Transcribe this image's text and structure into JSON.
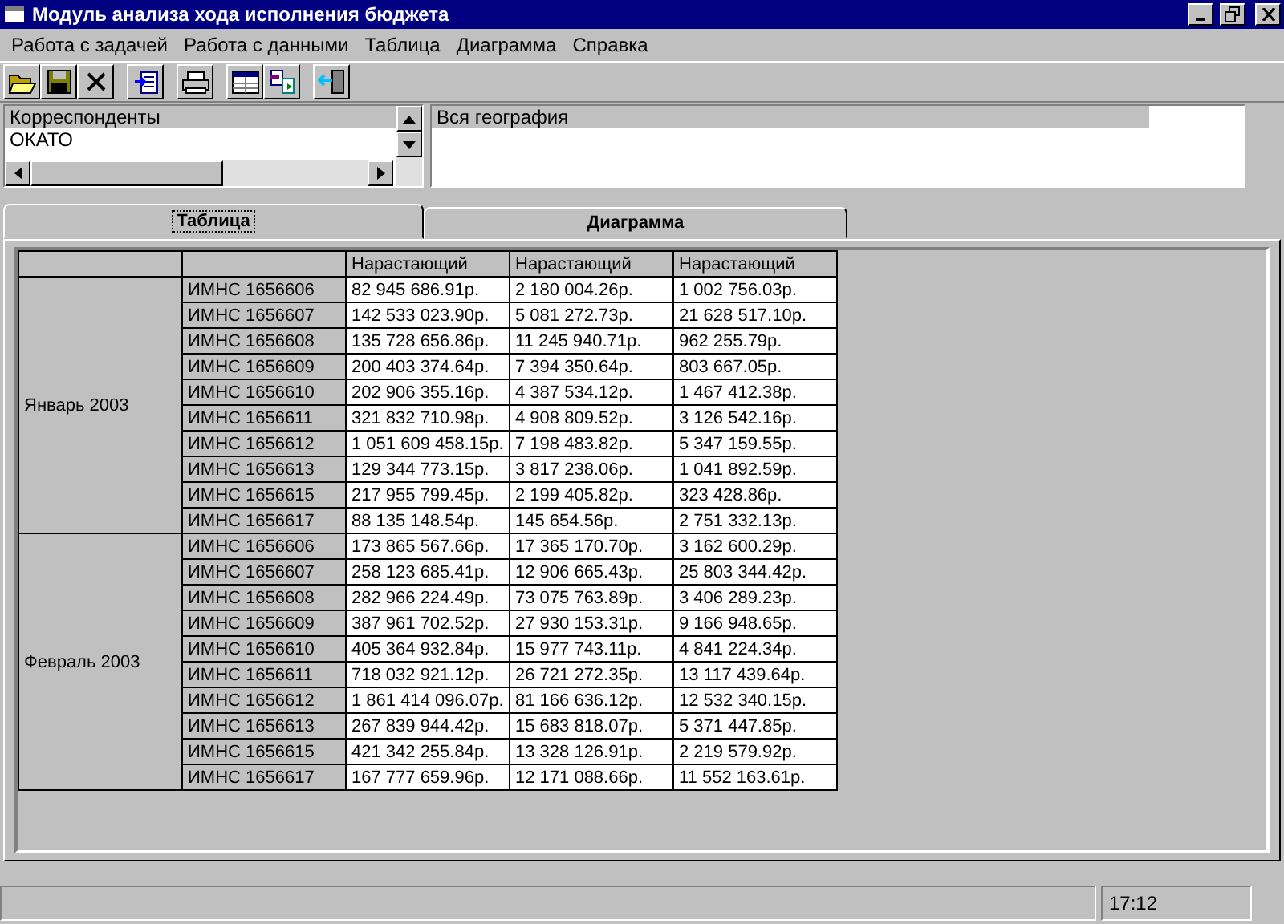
{
  "window": {
    "title": "Модуль анализа хода исполнения бюджета"
  },
  "menu": [
    "Работа с задачей",
    "Работа с данными",
    "Таблица",
    "Диаграмма",
    "Справка"
  ],
  "toolbar": [
    {
      "kind": "open"
    },
    {
      "kind": "save"
    },
    {
      "kind": "delete"
    },
    {
      "kind": "separator"
    },
    {
      "kind": "import"
    },
    {
      "kind": "separator"
    },
    {
      "kind": "print"
    },
    {
      "kind": "separator"
    },
    {
      "kind": "table"
    },
    {
      "kind": "transfer"
    },
    {
      "kind": "separator"
    },
    {
      "kind": "exit"
    }
  ],
  "left_list": {
    "items": [
      {
        "label": "Корреспонденты",
        "selected": true
      },
      {
        "label": "ОКАТО",
        "selected": false
      }
    ]
  },
  "right_list": {
    "items": [
      {
        "label": "Вся география",
        "selected": true
      }
    ]
  },
  "tabs": [
    {
      "label": "Таблица",
      "selected": true
    },
    {
      "label": "Диаграмма",
      "selected": false
    }
  ],
  "table": {
    "columns": [
      "Нарастающий",
      "Нарастающий",
      "Нарастающий"
    ],
    "groups": [
      {
        "label": "Январь 2003",
        "rows": [
          {
            "name": "ИМНС 1656606",
            "values": [
              "82 945 686.91р.",
              "2 180 004.26р.",
              "1 002 756.03р."
            ]
          },
          {
            "name": "ИМНС 1656607",
            "values": [
              "142 533 023.90р.",
              "5 081 272.73р.",
              "21 628 517.10р."
            ]
          },
          {
            "name": "ИМНС 1656608",
            "values": [
              "135 728 656.86р.",
              "11 245 940.71р.",
              "962 255.79р."
            ]
          },
          {
            "name": "ИМНС 1656609",
            "values": [
              "200 403 374.64р.",
              "7 394 350.64р.",
              "803 667.05р."
            ]
          },
          {
            "name": "ИМНС 1656610",
            "values": [
              "202 906 355.16р.",
              "4 387 534.12р.",
              "1 467 412.38р."
            ]
          },
          {
            "name": "ИМНС 1656611",
            "values": [
              "321 832 710.98р.",
              "4 908 809.52р.",
              "3 126 542.16р."
            ]
          },
          {
            "name": "ИМНС 1656612",
            "values": [
              "1 051 609 458.15р.",
              "7 198 483.82р.",
              "5 347 159.55р."
            ]
          },
          {
            "name": "ИМНС 1656613",
            "values": [
              "129 344 773.15р.",
              "3 817 238.06р.",
              "1 041 892.59р."
            ]
          },
          {
            "name": "ИМНС 1656615",
            "values": [
              "217 955 799.45р.",
              "2 199 405.82р.",
              "323 428.86р."
            ]
          },
          {
            "name": "ИМНС 1656617",
            "values": [
              "88 135 148.54р.",
              "145 654.56р.",
              "2 751 332.13р."
            ]
          }
        ]
      },
      {
        "label": "Февраль 2003",
        "rows": [
          {
            "name": "ИМНС 1656606",
            "values": [
              "173 865 567.66р.",
              "17 365 170.70р.",
              "3 162 600.29р."
            ]
          },
          {
            "name": "ИМНС 1656607",
            "values": [
              "258 123 685.41р.",
              "12 906 665.43р.",
              "25 803 344.42р."
            ]
          },
          {
            "name": "ИМНС 1656608",
            "values": [
              "282 966 224.49р.",
              "73 075 763.89р.",
              "3 406 289.23р."
            ]
          },
          {
            "name": "ИМНС 1656609",
            "values": [
              "387 961 702.52р.",
              "27 930 153.31р.",
              "9 166 948.65р."
            ]
          },
          {
            "name": "ИМНС 1656610",
            "values": [
              "405 364 932.84р.",
              "15 977 743.11р.",
              "4 841 224.34р."
            ]
          },
          {
            "name": "ИМНС 1656611",
            "values": [
              "718 032 921.12р.",
              "26 721 272.35р.",
              "13 117 439.64р."
            ]
          },
          {
            "name": "ИМНС 1656612",
            "values": [
              "1 861 414 096.07р.",
              "81 166 636.12р.",
              "12 532 340.15р."
            ]
          },
          {
            "name": "ИМНС 1656613",
            "values": [
              "267 839 944.42р.",
              "15 683 818.07р.",
              "5 371 447.85р."
            ]
          },
          {
            "name": "ИМНС 1656615",
            "values": [
              "421 342 255.84р.",
              "13 328 126.91р.",
              "2 219 579.92р."
            ]
          },
          {
            "name": "ИМНС 1656617",
            "values": [
              "167 777 659.96р.",
              "12 171 088.66р.",
              "11 552 163.61р."
            ]
          }
        ]
      }
    ]
  },
  "status_bar": {
    "time": "17:12"
  }
}
